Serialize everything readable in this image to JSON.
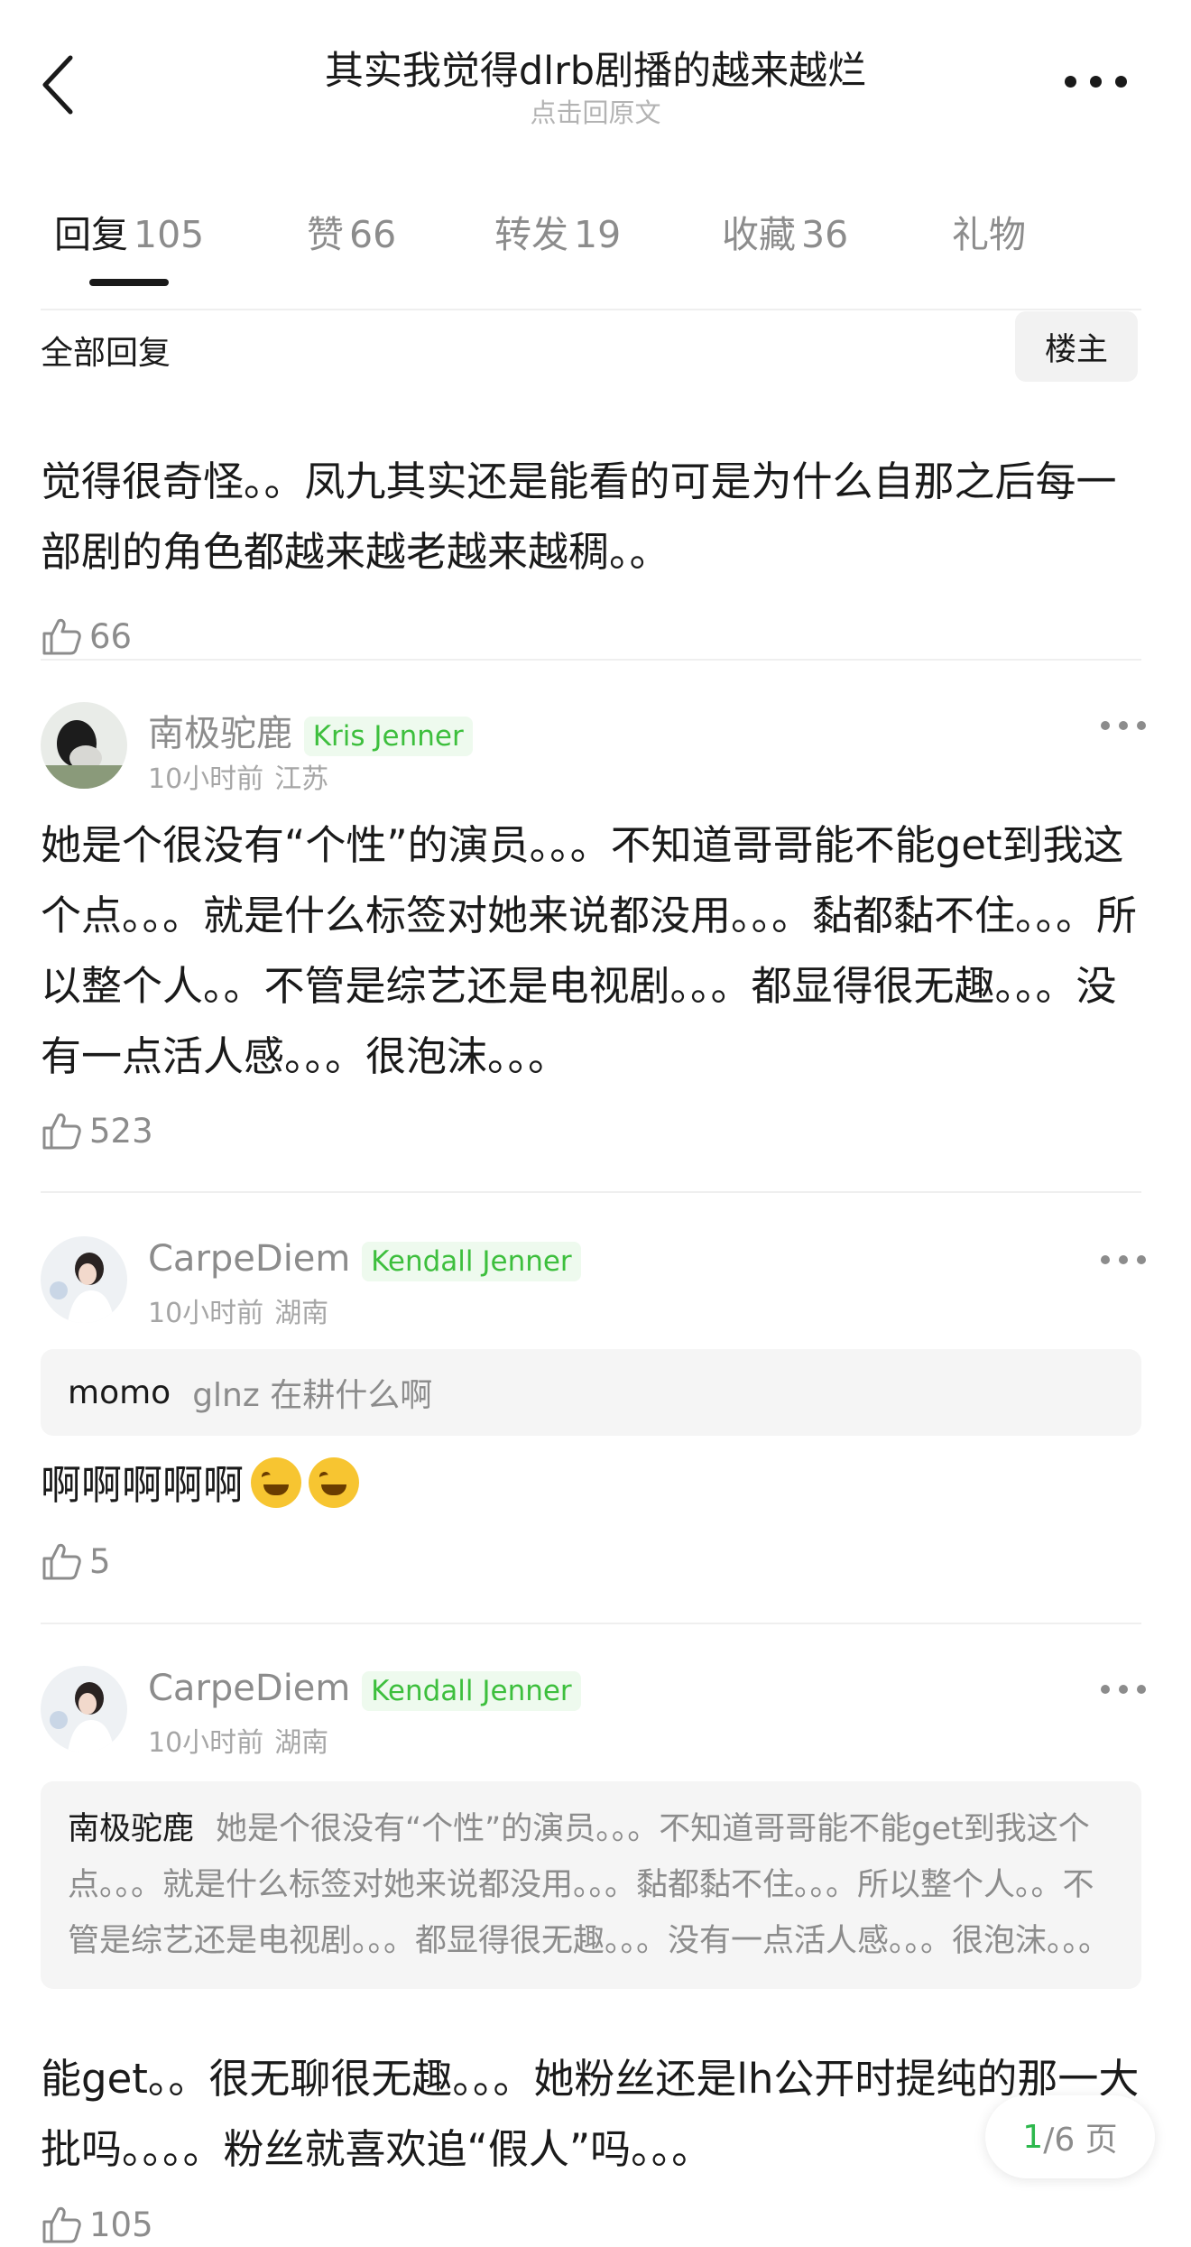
{
  "header": {
    "title": "其实我觉得dlrb剧播的越来越烂",
    "subtitle": "点击回原文"
  },
  "tabs": [
    {
      "label": "回复",
      "count": "105",
      "active": true
    },
    {
      "label": "赞",
      "count": "66"
    },
    {
      "label": "转发",
      "count": "19"
    },
    {
      "label": "收藏",
      "count": "36"
    },
    {
      "label": "礼物",
      "count": ""
    }
  ],
  "section": {
    "label": "全部回复",
    "owner_button": "楼主"
  },
  "main_post": {
    "text": "觉得很奇怪。。凤九其实还是能看的可是为什么自那之后每一部剧的角色都越来越老越来越稠。。",
    "likes": "66"
  },
  "comments": [
    {
      "username": "南极驼鹿",
      "badge": "Kris Jenner",
      "time": "10小时前",
      "location": "江苏",
      "text": "她是个很没有“个性”的演员。。。不知道哥哥能不能get到我这个点。。。就是什么标签对她来说都没用。。。黏都黏不住。。。所以整个人。。不管是综艺还是电视剧。。。都显得很无趣。。。没有一点活人感。。。很泡沫。。。",
      "likes": "523"
    },
    {
      "username": "CarpeDiem",
      "badge": "Kendall Jenner",
      "time": "10小时前",
      "location": "湖南",
      "quote_author": "momo",
      "quote_text": "glnz 在耕什么啊",
      "text": "啊啊啊啊啊",
      "emoji": "rolling-on-floor-laughing-icon",
      "likes": "5"
    },
    {
      "username": "CarpeDiem",
      "badge": "Kendall Jenner",
      "time": "10小时前",
      "location": "湖南",
      "quote_author": "南极驼鹿",
      "quote_text": "她是个很没有“个性”的演员。。。不知道哥哥能不能get到我这个点。。。就是什么标签对她来说都没用。。。黏都黏不住。。。所以整个人。。不管是综艺还是电视剧。。。都显得很无趣。。。没有一点活人感。。。很泡沫。。。",
      "text": "能get。。很无聊很无趣。。。她粉丝还是lh公开时提纯的那一大批吗。。。。粉丝就喜欢追“假人”吗。。。",
      "likes": "105"
    }
  ],
  "pager": {
    "current": "1",
    "total_text": "/6 页"
  },
  "colors": {
    "badge_green": "#3dbf3d",
    "pager_green": "#2db84d",
    "muted_gray": "#8c8c8c"
  }
}
